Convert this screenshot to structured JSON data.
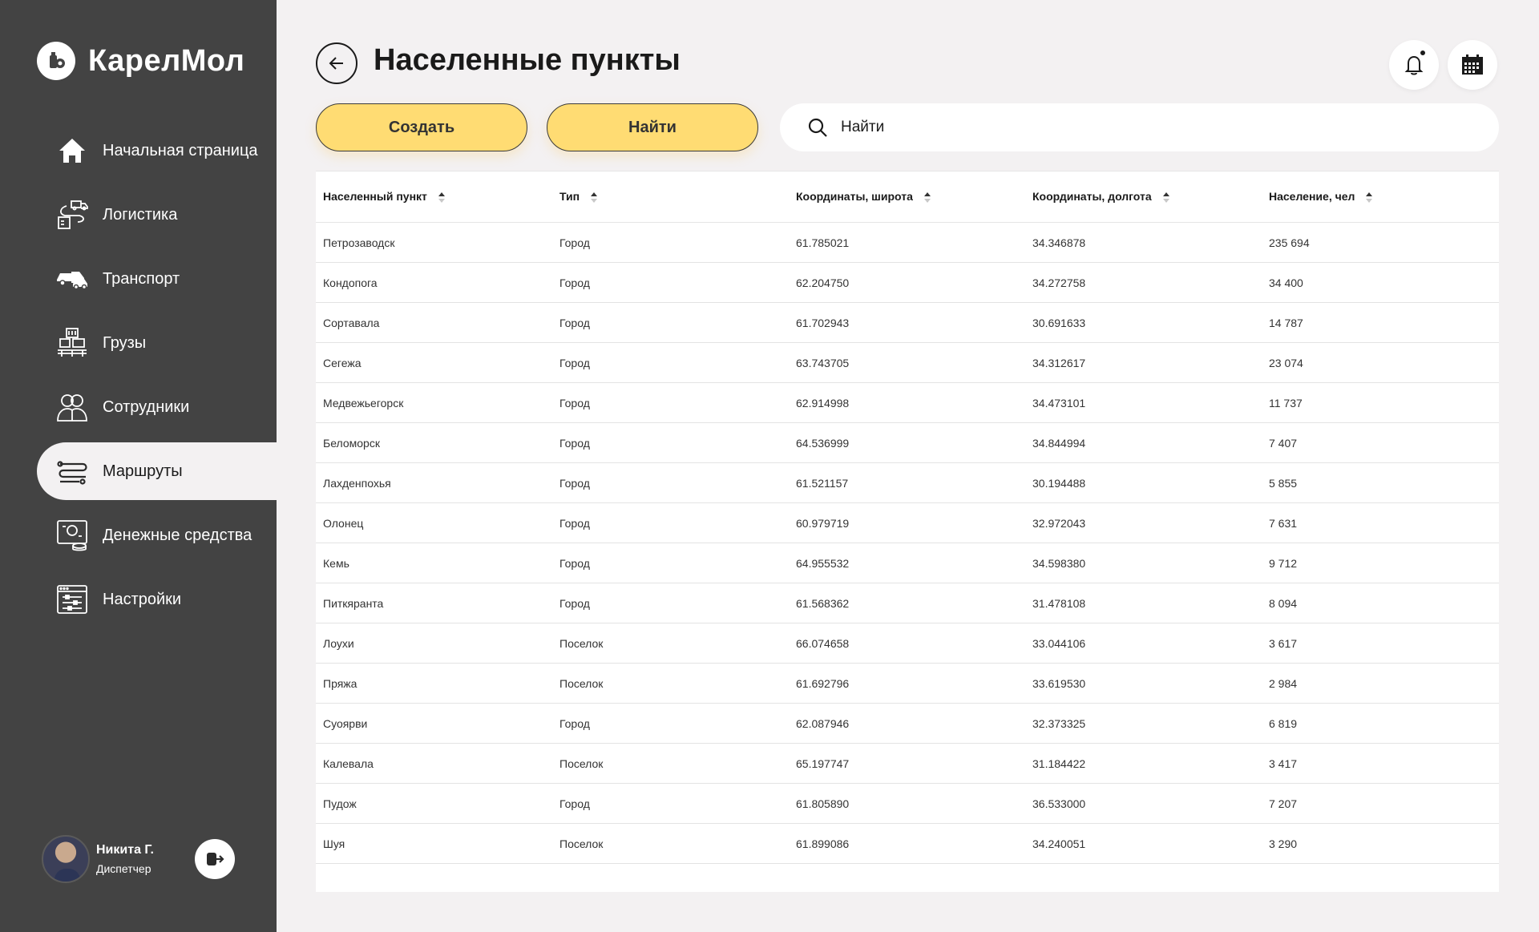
{
  "brand": {
    "name": "КарелМол"
  },
  "nav": {
    "items": [
      {
        "label": "Начальная страница",
        "icon": "home-icon"
      },
      {
        "label": "Логистика",
        "icon": "logistics-icon"
      },
      {
        "label": "Транспорт",
        "icon": "transport-icon"
      },
      {
        "label": "Грузы",
        "icon": "cargo-icon"
      },
      {
        "label": "Сотрудники",
        "icon": "employees-icon"
      },
      {
        "label": "Маршруты",
        "icon": "routes-icon",
        "active": true
      },
      {
        "label": "Денежные средства",
        "icon": "money-icon"
      },
      {
        "label": "Настройки",
        "icon": "settings-icon"
      }
    ]
  },
  "user": {
    "name": "Никита Г.",
    "role": "Диспетчер"
  },
  "header": {
    "title": "Населенные пункты"
  },
  "toolbar": {
    "create_label": "Создать",
    "find_label": "Найти",
    "search_placeholder": "Найти"
  },
  "colors": {
    "sidebar": "#434343",
    "accent": "#ffdc73",
    "background": "#f3f1f2"
  },
  "table": {
    "columns": [
      "Населенный пункт",
      "Тип",
      "Координаты, широта",
      "Координаты, долгота",
      "Население, чел"
    ],
    "rows": [
      [
        "Петрозаводск",
        "Город",
        "61.785021",
        "34.346878",
        "235 694"
      ],
      [
        "Кондопога",
        "Город",
        "62.204750",
        "34.272758",
        "34 400"
      ],
      [
        "Сортавала",
        "Город",
        "61.702943",
        "30.691633",
        "14 787"
      ],
      [
        "Сегежа",
        "Город",
        "63.743705",
        "34.312617",
        "23 074"
      ],
      [
        "Медвежьегорск",
        "Город",
        "62.914998",
        "34.473101",
        "11 737"
      ],
      [
        "Беломорск",
        "Город",
        "64.536999",
        "34.844994",
        "7 407"
      ],
      [
        "Лахденпохья",
        "Город",
        "61.521157",
        "30.194488",
        "5 855"
      ],
      [
        "Олонец",
        "Город",
        "60.979719",
        "32.972043",
        "7 631"
      ],
      [
        "Кемь",
        "Город",
        "64.955532",
        "34.598380",
        "9 712"
      ],
      [
        "Питкяранта",
        "Город",
        "61.568362",
        "31.478108",
        "8 094"
      ],
      [
        "Лоухи",
        "Поселок",
        "66.074658",
        "33.044106",
        "3 617"
      ],
      [
        "Пряжа",
        "Поселок",
        "61.692796",
        "33.619530",
        "2 984"
      ],
      [
        "Суоярви",
        "Город",
        "62.087946",
        "32.373325",
        "6 819"
      ],
      [
        "Калевала",
        "Поселок",
        "65.197747",
        "31.184422",
        "3 417"
      ],
      [
        "Пудож",
        "Город",
        "61.805890",
        "36.533000",
        "7 207"
      ],
      [
        "Шуя",
        "Поселок",
        "61.899086",
        "34.240051",
        "3 290"
      ]
    ]
  }
}
